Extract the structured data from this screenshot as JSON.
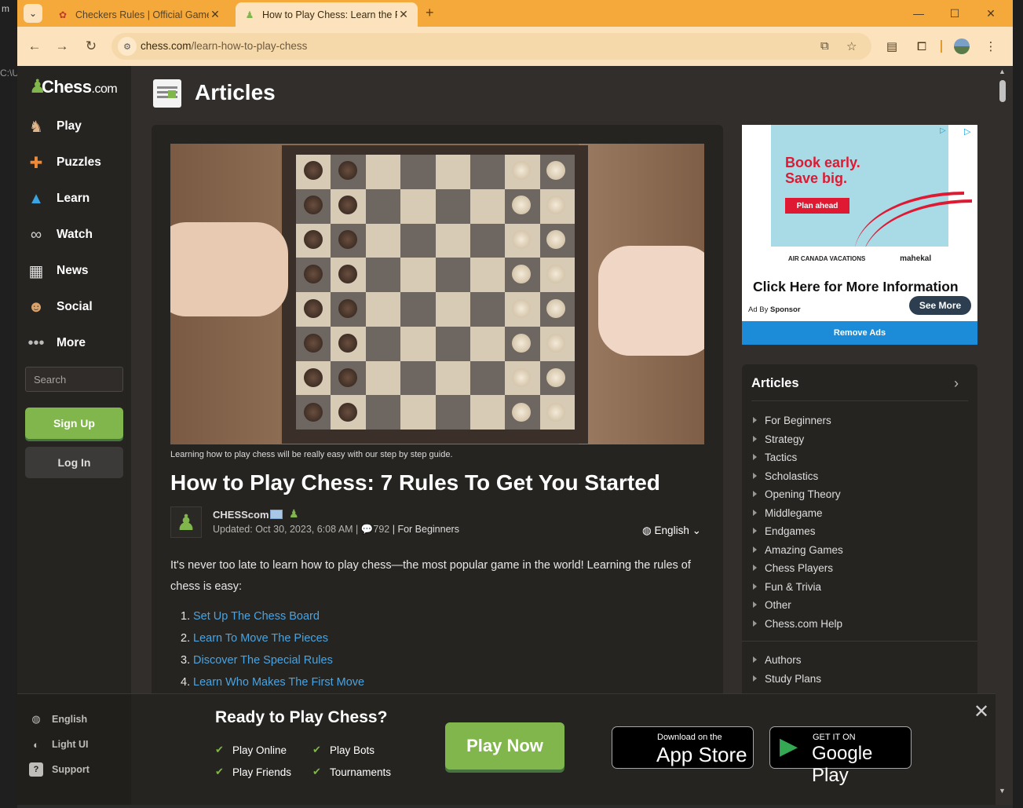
{
  "desktop": {
    "left_stub": "m",
    "path_fragment": "C:\\U"
  },
  "browser": {
    "tabs": [
      {
        "title": "Checkers Rules | Official Game R",
        "favicon": "ladybug-icon",
        "active": false
      },
      {
        "title": "How to Play Chess: Learn the Ru",
        "favicon": "chess-pawn-icon",
        "active": true
      }
    ],
    "url_domain": "chess.com",
    "url_path": "/learn-how-to-play-chess",
    "accent_color": "#f6a93b"
  },
  "sidebar": {
    "logo": {
      "main": "Chess",
      "suffix": ".com"
    },
    "items": [
      {
        "label": "Play",
        "icon": "play-hand-icon"
      },
      {
        "label": "Puzzles",
        "icon": "puzzle-icon"
      },
      {
        "label": "Learn",
        "icon": "graduation-cap-icon"
      },
      {
        "label": "Watch",
        "icon": "binoculars-icon"
      },
      {
        "label": "News",
        "icon": "newspaper-icon"
      },
      {
        "label": "Social",
        "icon": "people-icon"
      },
      {
        "label": "More",
        "icon": "more-dots-icon"
      }
    ],
    "search_placeholder": "Search",
    "signup_label": "Sign Up",
    "login_label": "Log In"
  },
  "header": {
    "title": "Articles"
  },
  "article": {
    "caption": "Learning how to play chess will be really easy with our step by step guide.",
    "title": "How to Play Chess: 7 Rules To Get You Started",
    "author": "CHESScom",
    "updated": "Updated: Oct 30, 2023, 6:08 AM |",
    "comments": "792",
    "category": "| For Beginners",
    "language": "English",
    "intro": "It's never too late to learn how to play chess—the most popular game in the world! Learning the rules of chess is easy:",
    "toc": [
      {
        "num": "1.",
        "label": "Set Up The Chess Board"
      },
      {
        "num": "2.",
        "label": "Learn To Move The Pieces"
      },
      {
        "num": "3.",
        "label": "Discover The Special Rules"
      },
      {
        "num": "4.",
        "label": "Learn Who Makes The First Move"
      }
    ]
  },
  "ad": {
    "headline_1": "Book early.",
    "headline_2": "Save big.",
    "cta": "Plan ahead",
    "brand_1": "AIR CANADA VACATIONS",
    "brand_2": "mahekal",
    "click_text": "Click Here for More Information",
    "ad_by": "Ad By",
    "sponsor": "Sponsor",
    "see_more": "See More",
    "remove_ads": "Remove Ads",
    "brand_color": "#e01933"
  },
  "categories": {
    "title": "Articles",
    "items": [
      "For Beginners",
      "Strategy",
      "Tactics",
      "Scholastics",
      "Opening Theory",
      "Middlegame",
      "Endgames",
      "Amazing Games",
      "Chess Players",
      "Fun & Trivia",
      "Other",
      "Chess.com Help"
    ],
    "extra": [
      "Authors",
      "Study Plans"
    ]
  },
  "footer": {
    "side": [
      {
        "label": "English",
        "icon": "globe-icon"
      },
      {
        "label": "Light UI",
        "icon": "contrast-icon"
      },
      {
        "label": "Support",
        "icon": "help-icon"
      }
    ],
    "promo_title": "Ready to Play Chess?",
    "features": [
      "Play Online",
      "Play Bots",
      "Play Friends",
      "Tournaments"
    ],
    "play_now": "Play Now",
    "app_store_small": "Download on the",
    "app_store_big": "App Store",
    "google_small": "GET IT ON",
    "google_big": "Google Play",
    "primary_color": "#81b64c"
  }
}
